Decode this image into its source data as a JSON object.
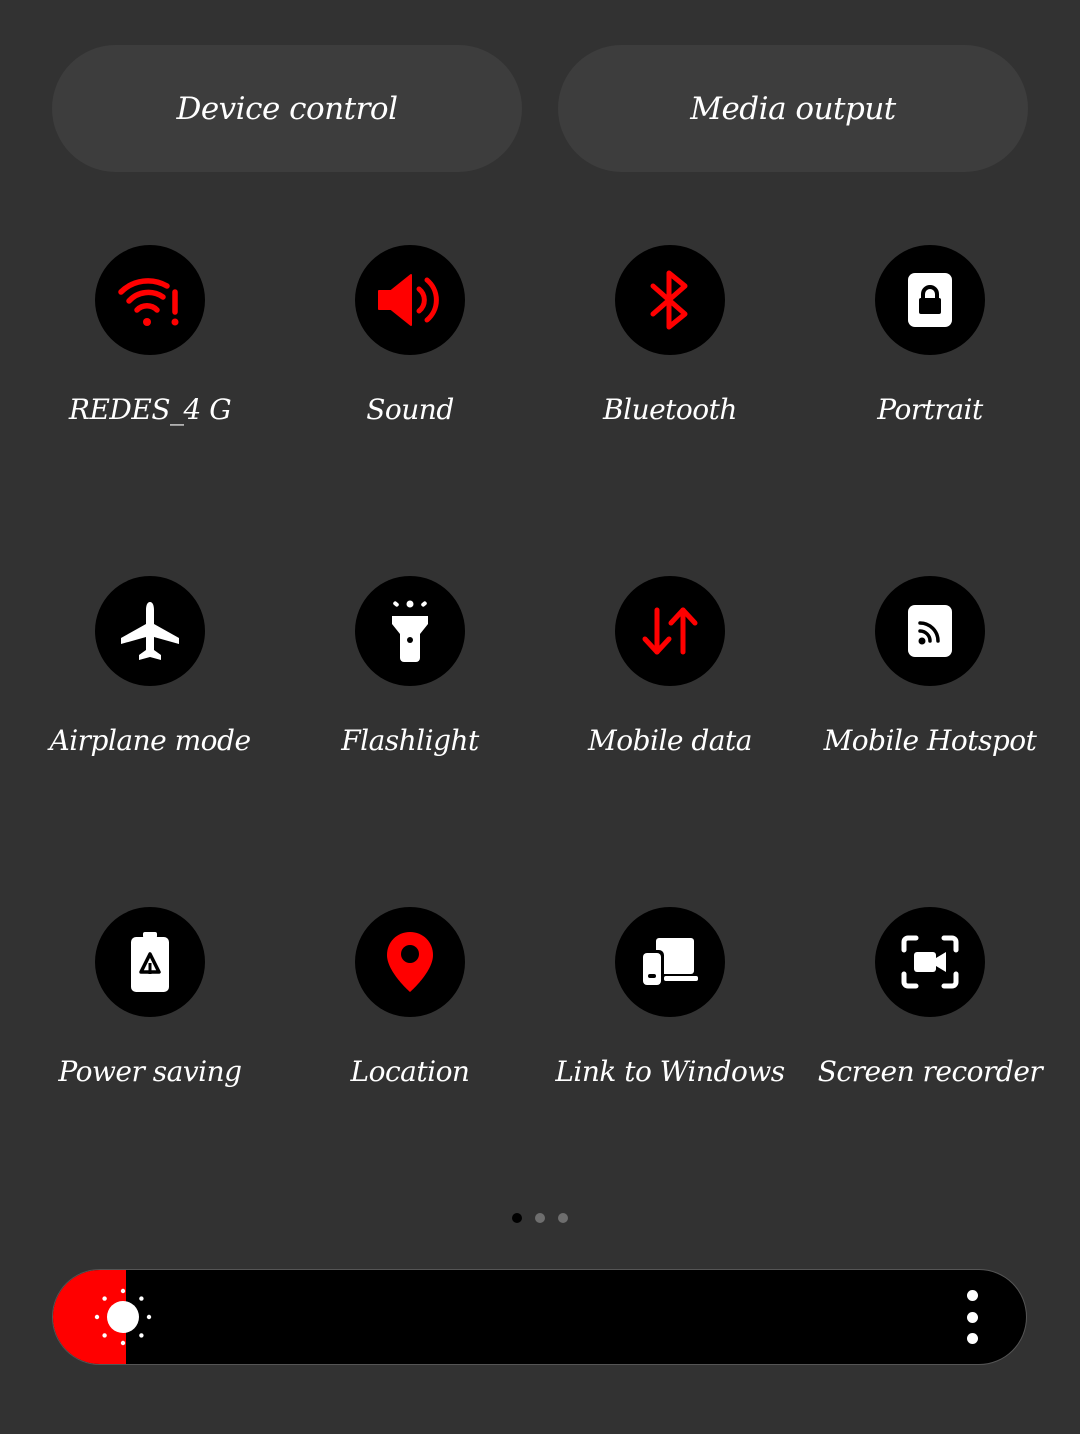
{
  "top_buttons": {
    "device_control": "Device control",
    "media_output": "Media output"
  },
  "tiles": [
    {
      "label": "REDES_4 G",
      "icon": "wifi-alert-icon",
      "active": true
    },
    {
      "label": "Sound",
      "icon": "volume-icon",
      "active": true
    },
    {
      "label": "Bluetooth",
      "icon": "bluetooth-icon",
      "active": true
    },
    {
      "label": "Portrait",
      "icon": "rotation-lock-icon",
      "active": false
    },
    {
      "label": "Airplane mode",
      "icon": "airplane-icon",
      "active": false
    },
    {
      "label": "Flashlight",
      "icon": "flashlight-icon",
      "active": false
    },
    {
      "label": "Mobile data",
      "icon": "mobile-data-icon",
      "active": true
    },
    {
      "label": "Mobile Hotspot",
      "icon": "hotspot-icon",
      "active": false
    },
    {
      "label": "Power saving",
      "icon": "power-saving-icon",
      "active": false
    },
    {
      "label": "Location",
      "icon": "location-pin-icon",
      "active": true
    },
    {
      "label": "Link to Windows",
      "icon": "link-to-windows-icon",
      "active": false
    },
    {
      "label": "Screen recorder",
      "icon": "screen-recorder-icon",
      "active": false
    }
  ],
  "pagination": {
    "pages": 3,
    "current": 1
  },
  "brightness": {
    "level": 0.075
  },
  "colors": {
    "background": "#323232",
    "accent": "#ff0000",
    "tile_bg": "#000000",
    "icon_inactive": "#ffffff"
  }
}
